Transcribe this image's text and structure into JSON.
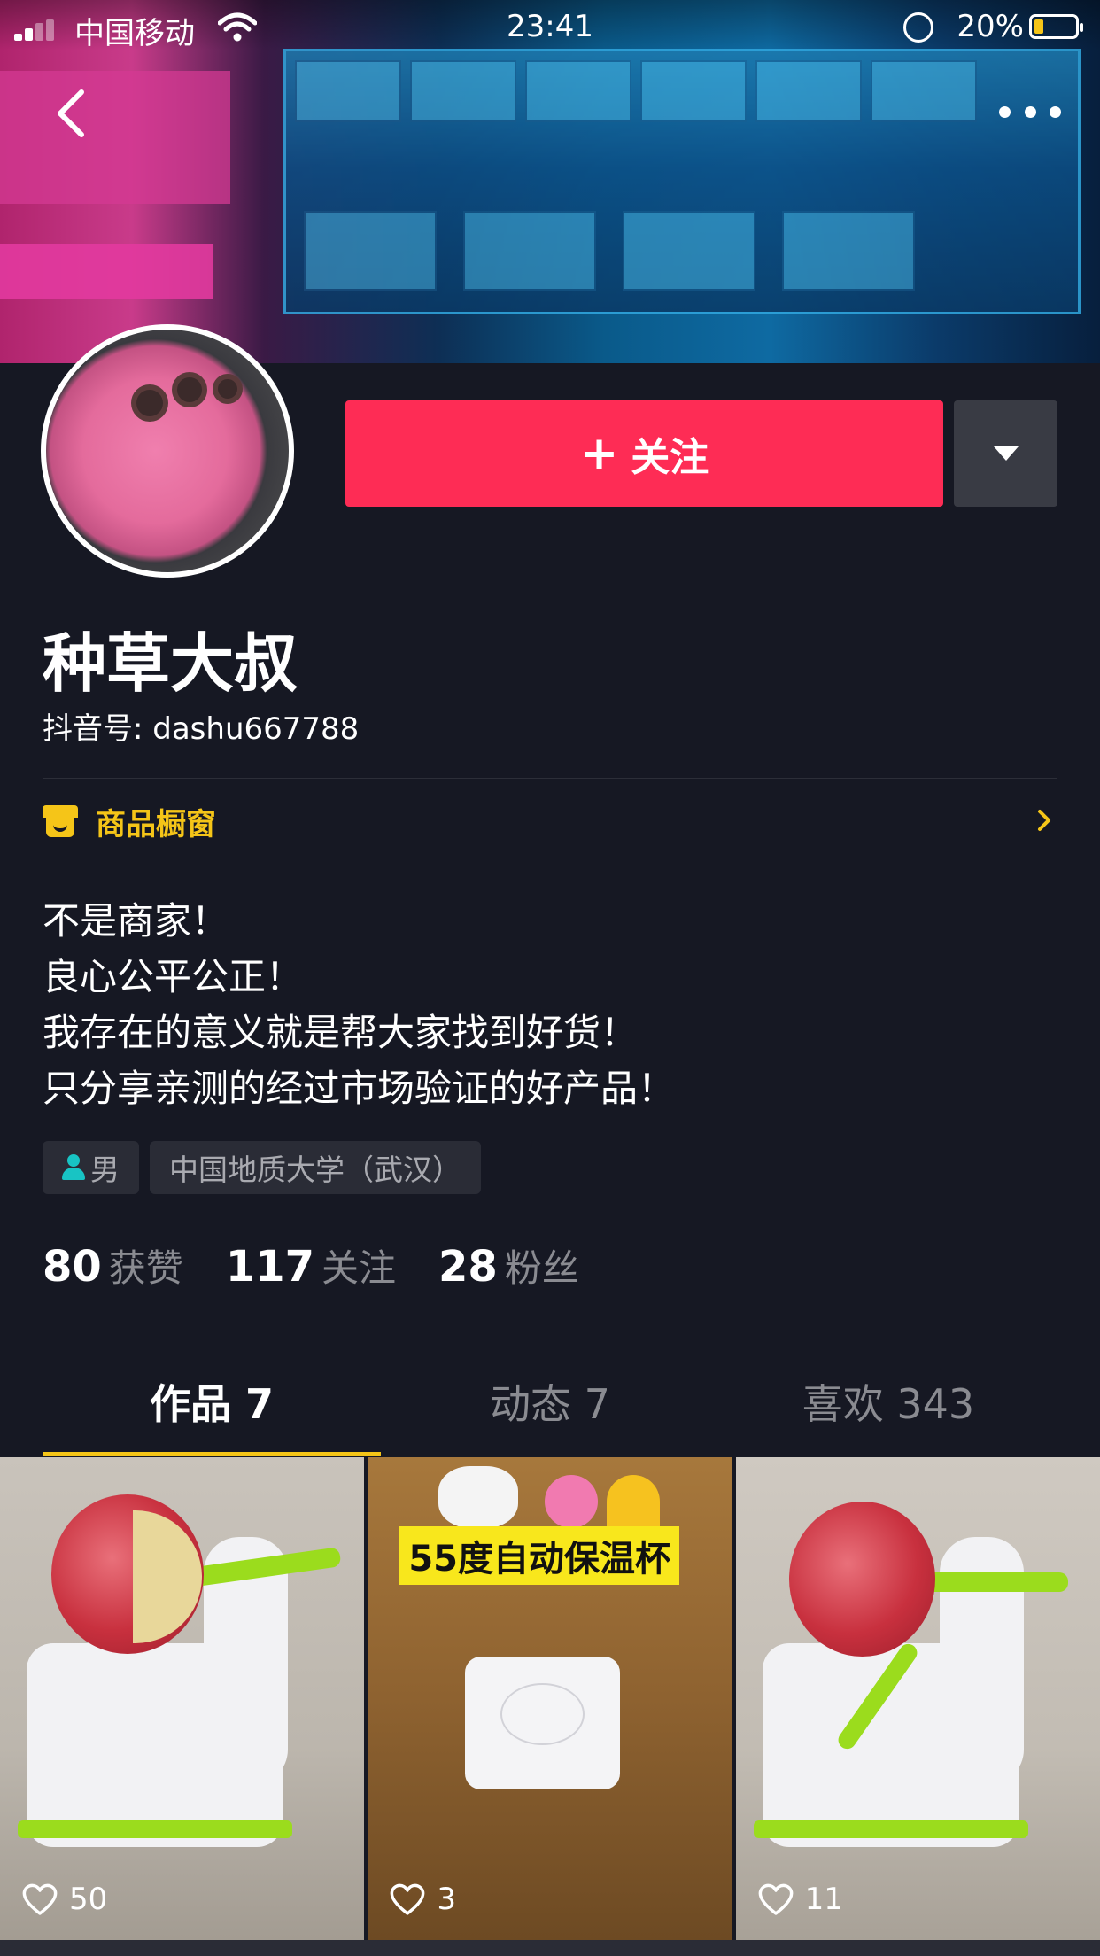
{
  "status_bar": {
    "carrier": "中国移动",
    "time": "23:41",
    "battery_percent": "20%"
  },
  "profile": {
    "name": "种草大叔",
    "account_id": "抖音号: dashu667788",
    "follow_label": "关注",
    "follow_plus": "+",
    "shop_label": "商品橱窗",
    "bio": [
      "不是商家！",
      "良心公平公正！",
      "我存在的意义就是帮大家找到好货！",
      "只分享亲测的经过市场验证的好产品！"
    ],
    "tags": {
      "gender": "男",
      "school": "中国地质大学（武汉）"
    },
    "stats": [
      {
        "num": "80",
        "label": "获赞"
      },
      {
        "num": "117",
        "label": "关注"
      },
      {
        "num": "28",
        "label": "粉丝"
      }
    ]
  },
  "tabs": [
    {
      "label": "作品 7",
      "active": true
    },
    {
      "label": "动态 7",
      "active": false
    },
    {
      "label": "喜欢 343",
      "active": false
    }
  ],
  "videos": [
    {
      "likes": "50"
    },
    {
      "likes": "3",
      "overlay_text": "55度自动保温杯"
    },
    {
      "likes": "11"
    }
  ],
  "colors": {
    "background": "#161823",
    "follow": "#fe2c55",
    "accent": "#f5c518",
    "muted": "#8a8b91"
  },
  "icons": [
    "back-icon",
    "more-icon",
    "shop-icon",
    "chevron-right-icon",
    "person-icon",
    "heart-icon",
    "dropdown-icon"
  ]
}
